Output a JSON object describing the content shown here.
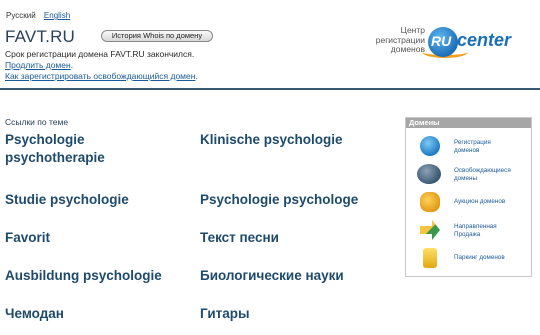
{
  "header": {
    "lang_ru": "Русский",
    "lang_en": "English",
    "site_title": "FAVT.RU",
    "whois_button": "История Whois по домену",
    "expired_text": "Срок регистрации домена FAVT.RU закончился.",
    "renew_link": "Продлить домен",
    "how_to_link": "Как зарегистрировать освобождающийся домен",
    "logo_text_1": "Центр",
    "logo_text_2": "регистрации",
    "logo_text_3": "доменов",
    "logo_ru": "RU",
    "logo_center": "center"
  },
  "links": {
    "heading": "Ссылки по теме",
    "items": [
      "Psychologie psychotherapie",
      "Klinische psychologie",
      "Studie psychologie",
      "Psychologie psychologe",
      "Favorit",
      "Текст песни",
      "Ausbildung psychologie",
      "Биологические науки",
      "Чемодан",
      "Гитары"
    ]
  },
  "domains": {
    "title": "Домены",
    "items": [
      {
        "label_1": "Регистрация",
        "label_2": "доменов",
        "icon": "globe-icon"
      },
      {
        "label_1": "Освобождающиеся",
        "label_2": "домены",
        "icon": "ru-globe-icon"
      },
      {
        "label_1": "Аукцион доменов",
        "label_2": "",
        "icon": "auction-icon"
      },
      {
        "label_1": "Направленная",
        "label_2": "Продажа",
        "icon": "arrow-icon"
      },
      {
        "label_1": "Паркинг доменов",
        "label_2": "",
        "icon": "parking-icon"
      }
    ]
  }
}
